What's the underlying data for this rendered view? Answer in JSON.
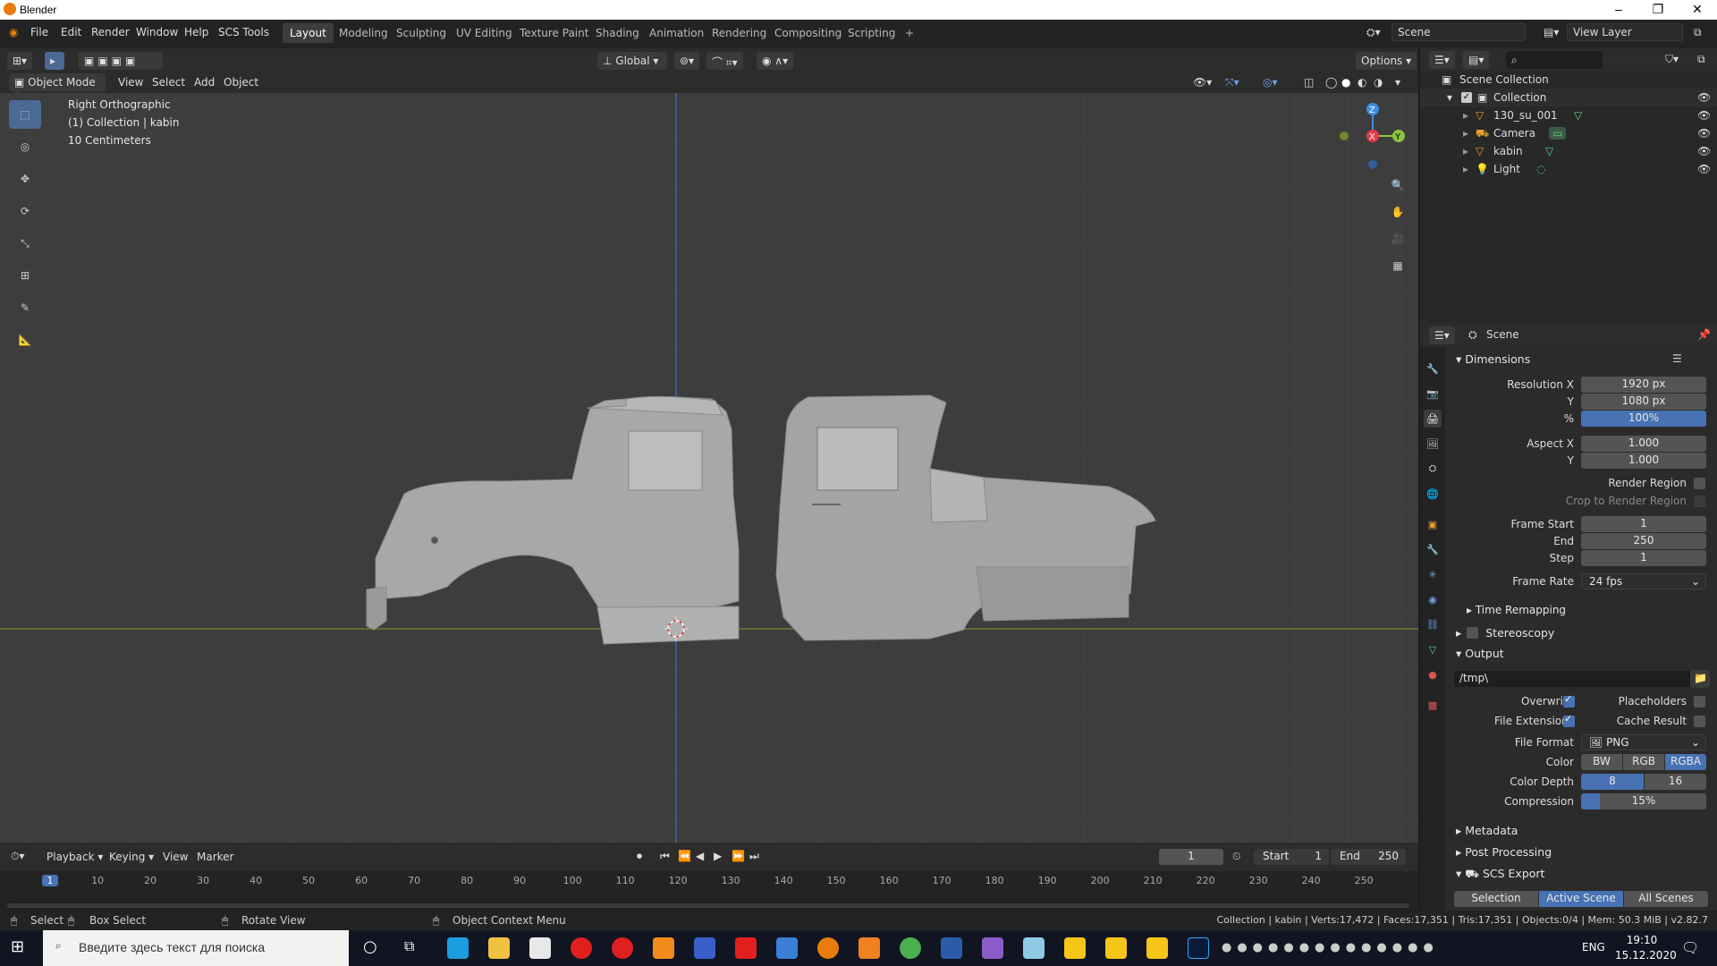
{
  "window": {
    "title": "Blender"
  },
  "topbar": {
    "menus": [
      "File",
      "Edit",
      "Render",
      "Window",
      "Help",
      "SCS Tools"
    ],
    "workspaces": [
      "Layout",
      "Modeling",
      "Sculpting",
      "UV Editing",
      "Texture Paint",
      "Shading",
      "Animation",
      "Rendering",
      "Compositing",
      "Scripting"
    ],
    "active_workspace": "Layout",
    "scene_name": "Scene",
    "view_layer": "View Layer"
  },
  "viewport_tool": {
    "orientation": "Global",
    "options": "Options"
  },
  "viewport_header": {
    "mode": "Object Mode",
    "menus": [
      "View",
      "Select",
      "Add",
      "Object"
    ]
  },
  "viewport": {
    "view_name": "Right Orthographic",
    "collection_line": "(1) Collection | kabin",
    "scale": "10 Centimeters",
    "gizmo": {
      "z": "Z",
      "y": "Y",
      "x": "X"
    }
  },
  "outliner": {
    "root": "Scene Collection",
    "collection": "Collection",
    "items": [
      "130_su_001",
      "Camera",
      "kabin",
      "Light"
    ]
  },
  "properties": {
    "context": "Scene",
    "dimensions": {
      "title": "Dimensions",
      "res_x_label": "Resolution X",
      "res_x": "1920 px",
      "res_y_label": "Y",
      "res_y": "1080 px",
      "pct_label": "%",
      "pct": "100%",
      "aspect_x_label": "Aspect X",
      "aspect_x": "1.000",
      "aspect_y_label": "Y",
      "aspect_y": "1.000",
      "render_region": "Render Region",
      "crop": "Crop to Render Region",
      "frame_start_label": "Frame Start",
      "frame_start": "1",
      "end_label": "End",
      "end": "250",
      "step_label": "Step",
      "step": "1",
      "frame_rate_label": "Frame Rate",
      "frame_rate": "24 fps",
      "time_remapping": "Time Remapping"
    },
    "stereoscopy": "Stereoscopy",
    "output": {
      "title": "Output",
      "path": "/tmp\\",
      "overwrite": "Overwrite",
      "placeholders": "Placeholders",
      "file_extensions": "File Extensions",
      "cache_result": "Cache Result",
      "file_format_label": "File Format",
      "file_format": "PNG",
      "color_label": "Color",
      "color_options": [
        "BW",
        "RGB",
        "RGBA"
      ],
      "color_selected": "RGBA",
      "depth_label": "Color Depth",
      "depth_options": [
        "8",
        "16"
      ],
      "depth_selected": "8",
      "compression_label": "Compression",
      "compression": "15%",
      "compression_level": 0.15
    },
    "metadata": "Metadata",
    "post_processing": "Post Processing",
    "scs_export": {
      "title": "SCS Export",
      "options": [
        "Selection",
        "Active Scene",
        "All Scenes"
      ],
      "selected": "Active Scene"
    }
  },
  "timeline": {
    "menus": [
      "Playback",
      "Keying",
      "View",
      "Marker"
    ],
    "current_frame": "1",
    "start_label": "Start",
    "start": "1",
    "end_label": "End",
    "end": "250",
    "ruler": [
      "1",
      "10",
      "20",
      "30",
      "40",
      "50",
      "60",
      "70",
      "80",
      "90",
      "100",
      "110",
      "120",
      "130",
      "140",
      "150",
      "160",
      "170",
      "180",
      "190",
      "200",
      "210",
      "220",
      "230",
      "240",
      "250"
    ]
  },
  "statusbar": {
    "select": "Select",
    "box_select": "Box Select",
    "rotate": "Rotate View",
    "context_menu": "Object Context Menu",
    "stats": "Collection | kabin | Verts:17,472 | Faces:17,351 | Tris:17,351 | Objects:0/4 | Mem: 50.3 MiB | v2.82.7"
  },
  "taskbar": {
    "search_placeholder": "Введите здесь текст для поиска",
    "lang": "ENG",
    "time": "19:10",
    "date": "15.12.2020"
  },
  "colors": {
    "accent": "#4772b3",
    "bg": "#3d3d3d",
    "panel": "#2b2b2b",
    "x_axis": "#e23b4a",
    "y_axis": "#8bc53f",
    "z_axis": "#3b8fe2"
  }
}
